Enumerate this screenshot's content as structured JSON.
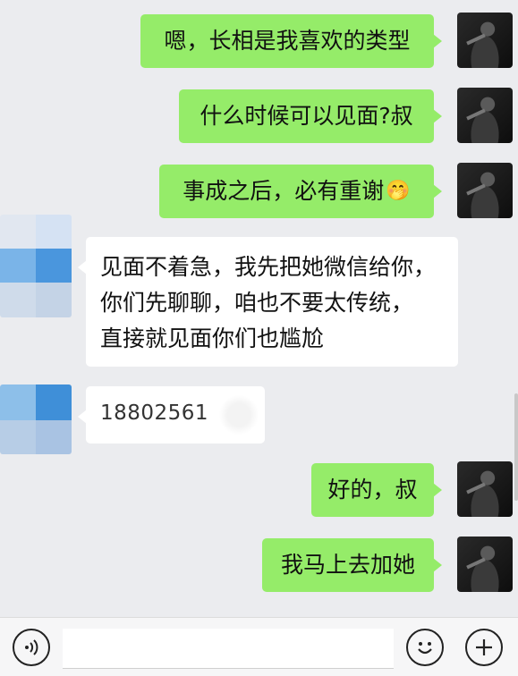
{
  "colors": {
    "outgoing": "#95ec69",
    "incoming": "#ffffff",
    "background": "#ebecef"
  },
  "messages": [
    {
      "side": "right",
      "text": "嗯，长相是我喜欢的类型"
    },
    {
      "side": "right",
      "text": "什么时候可以见面?叔"
    },
    {
      "side": "right",
      "text": "事成之后，必有重谢",
      "emoji": "🤭"
    },
    {
      "side": "left",
      "lines": [
        "见面不着急，我先把她微信给你，",
        "你们先聊聊，咱也不要太传统，",
        "直接就见面你们也尴尬"
      ]
    },
    {
      "side": "left",
      "text": "18802561"
    },
    {
      "side": "right",
      "text": "好的，叔"
    },
    {
      "side": "right",
      "text": "我马上去加她"
    }
  ],
  "input_bar": {
    "voice_icon": "voice-icon",
    "emoji_icon": "emoji-icon",
    "add_icon": "plus-icon",
    "input_value": ""
  }
}
